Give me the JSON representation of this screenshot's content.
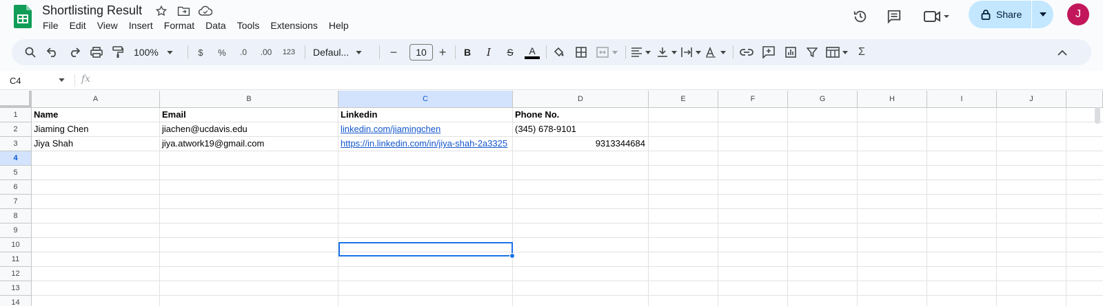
{
  "app": {
    "title": "Shortlisting Result",
    "menu": [
      "File",
      "Edit",
      "View",
      "Insert",
      "Format",
      "Data",
      "Tools",
      "Extensions",
      "Help"
    ],
    "share_label": "Share",
    "avatar_letter": "J",
    "accent": "#c2e7ff",
    "avatar_color": "#c2185b"
  },
  "toolbar": {
    "zoom": "100%",
    "currency": "$",
    "percent": "%",
    "dec_decrease": ".0",
    "dec_increase": ".00",
    "number_format": "123",
    "font": "Defaul...",
    "font_size": "10",
    "font_size_minus": "−",
    "font_size_plus": "+",
    "bold": "B",
    "italic": "I",
    "strike": "S",
    "text_color": "A",
    "functions": "Σ"
  },
  "formula_bar": {
    "cell_ref": "C4",
    "fx_label": "fx",
    "value": ""
  },
  "sheet": {
    "columns": [
      "A",
      "B",
      "C",
      "D",
      "E",
      "F",
      "G",
      "H",
      "I",
      "J"
    ],
    "rows": [
      "1",
      "2",
      "3",
      "4",
      "5",
      "6",
      "7",
      "8",
      "9",
      "10",
      "11",
      "12",
      "13",
      "14"
    ],
    "active_col": "C",
    "active_row": "4",
    "headers": [
      "Name",
      "Email",
      "Linkedin",
      "Phone No."
    ],
    "data": [
      [
        "Jiaming Chen",
        "jiachen@ucdavis.edu",
        "linkedin.com/jiamingchen",
        "(345) 678-9101"
      ],
      [
        "Jiya Shah",
        "jiya.atwork19@gmail.com",
        "https://in.linkedin.com/in/jiya-shah-2a3325",
        "9313344684"
      ]
    ]
  }
}
